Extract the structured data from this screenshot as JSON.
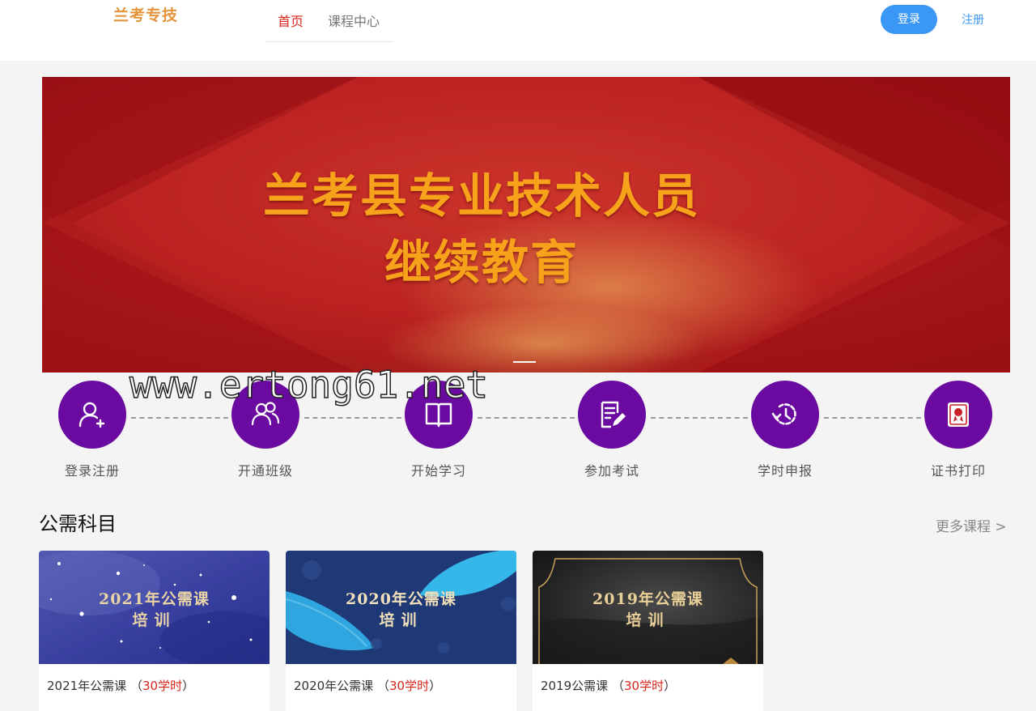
{
  "header": {
    "logo": "兰考专技",
    "nav": [
      {
        "label": "首页",
        "active": true
      },
      {
        "label": "课程中心",
        "active": false
      }
    ],
    "login_label": "登录",
    "register_label": "注册"
  },
  "banner": {
    "title_line1": "兰考县专业技术人员",
    "title_line2": "继续教育"
  },
  "watermark": "www.ertong61.net",
  "steps": [
    {
      "label": "登录注册",
      "icon": "user-add-icon"
    },
    {
      "label": "开通班级",
      "icon": "users-icon"
    },
    {
      "label": "开始学习",
      "icon": "book-icon"
    },
    {
      "label": "参加考试",
      "icon": "exam-edit-icon"
    },
    {
      "label": "学时申报",
      "icon": "clock-history-icon"
    },
    {
      "label": "证书打印",
      "icon": "certificate-icon"
    }
  ],
  "section": {
    "title": "公需科目",
    "more_label": "更多课程 >"
  },
  "courses": [
    {
      "image_line1": "2021年公需课",
      "image_line2": "培训",
      "name": "2021年公需课",
      "open": "（",
      "hours": "30学时",
      "close": "）"
    },
    {
      "image_line1": "2020年公需课",
      "image_line2": "培训",
      "name": "2020年公需课",
      "open": "（",
      "hours": "30学时",
      "close": "）"
    },
    {
      "image_line1": "2019年公需课",
      "image_line2": "培训",
      "name": "2019公需课",
      "open": "（",
      "hours": "30学时",
      "close": "）"
    }
  ],
  "colors": {
    "brand_red": "#d9261c",
    "primary_blue": "#3b97f5",
    "step_purple": "#6a0aa0",
    "banner_gold": "#f7a21b"
  }
}
